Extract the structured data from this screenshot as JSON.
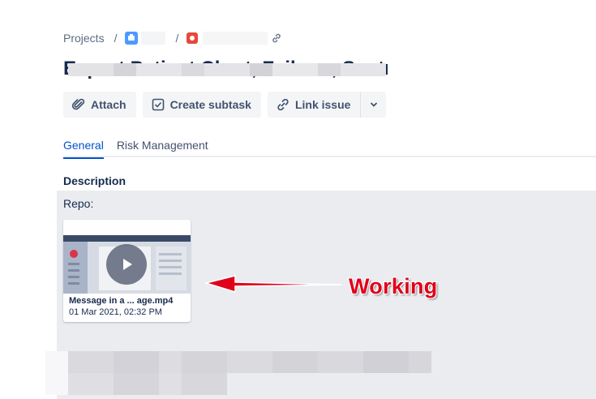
{
  "breadcrumb": {
    "projects_label": "Projects",
    "separator": "/",
    "project_icon": "project-avatar-icon",
    "issue_type_icon": "bug-icon",
    "copy_link_icon": "link-icon"
  },
  "issue": {
    "title": "Export Patient Chart, Failure , Sentry"
  },
  "toolbar": {
    "attach_label": "Attach",
    "create_subtask_label": "Create subtask",
    "link_issue_label": "Link issue"
  },
  "tabs": [
    {
      "label": "General",
      "active": true
    },
    {
      "label": "Risk Management",
      "active": false
    }
  ],
  "description": {
    "heading": "Description",
    "repo_label": "Repo:",
    "attachment": {
      "file_name": "Message in a ...  age.mp4",
      "date": "01 Mar 2021, 02:32 PM"
    }
  },
  "annotation": {
    "text": "Working",
    "color": "#e0001a"
  },
  "colors": {
    "accent": "#0052cc",
    "button_bg": "#f4f5f7",
    "description_bg": "#ebecf0"
  }
}
